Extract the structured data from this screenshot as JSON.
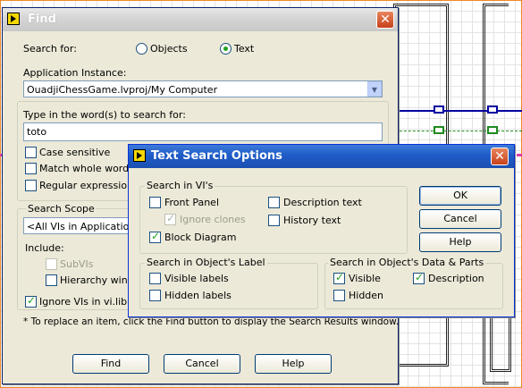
{
  "find": {
    "title": "Find",
    "search_for_label": "Search for:",
    "search_for_options": [
      "Objects",
      "Text"
    ],
    "search_for_selected": "Text",
    "app_instance_label": "Application Instance:",
    "app_instance_value": "OuadjiChessGame.lvproj/My Computer",
    "words_label": "Type in the word(s) to search for:",
    "words_value": "toto",
    "case_sensitive": "Case sensitive",
    "match_whole_word": "Match whole word",
    "regular_expression": "Regular expression",
    "search_scope_label": "Search Scope",
    "search_scope_value": "<All VIs in Application In",
    "include_label": "Include:",
    "subvis": "SubVIs",
    "hierarchy_window": "Hierarchy windo",
    "ignore_vis": "Ignore VIs in vi.lib",
    "note": "* To replace an item, click the Find button to display the Search Results window.",
    "buttons": {
      "find": "Find",
      "cancel": "Cancel",
      "help": "Help"
    }
  },
  "options": {
    "title": "Text Search Options",
    "search_in_vis_label": "Search in VI's",
    "front_panel": "Front Panel",
    "ignore_clones": "Ignore clones",
    "block_diagram": "Block Diagram",
    "description_text": "Description text",
    "history_text": "History text",
    "object_label_label": "Search in Object's Label",
    "visible_labels": "Visible labels",
    "hidden_labels": "Hidden labels",
    "data_parts_label": "Search in Object's Data & Parts",
    "visible": "Visible",
    "description": "Description",
    "hidden": "Hidden",
    "buttons": {
      "ok": "OK",
      "cancel": "Cancel",
      "help": "Help"
    },
    "checked": {
      "front_panel": false,
      "ignore_clones": true,
      "block_diagram": true,
      "description_text": false,
      "history_text": false,
      "visible_labels": false,
      "hidden_labels": false,
      "visible": true,
      "description": true,
      "hidden": false
    }
  },
  "colors": {
    "titlebar_active": "#1f5cc7",
    "dialog_bg": "#ece9d8",
    "check_green": "#21a121"
  }
}
